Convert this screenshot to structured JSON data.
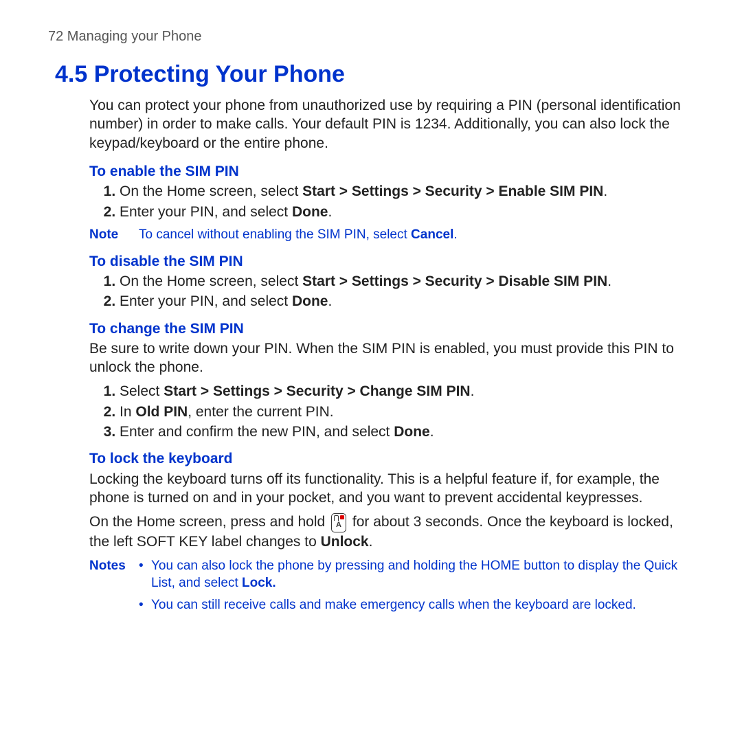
{
  "page_header": "72  Managing your Phone",
  "title": "4.5  Protecting Your Phone",
  "intro": "You can protect your phone from unauthorized use by requiring a PIN (personal identification number) in order to make calls. Your default PIN is 1234. Additionally, you can also lock the keypad/keyboard or the entire phone.",
  "sec1": {
    "head": "To enable the SIM PIN",
    "step1_pre": "On the Home screen, select ",
    "step1_bold": "Start > Settings > Security > Enable SIM PIN",
    "step1_post": ".",
    "step2_pre": "Enter your PIN, and select ",
    "step2_bold": "Done",
    "step2_post": ".",
    "note_label": "Note",
    "note_pre": "To cancel without enabling the SIM PIN, select ",
    "note_bold": "Cancel",
    "note_post": "."
  },
  "sec2": {
    "head": "To disable the SIM PIN",
    "step1_pre": "On the Home screen, select ",
    "step1_bold": "Start > Settings > Security > Disable SIM PIN",
    "step1_post": ".",
    "step2_pre": "Enter your PIN, and select ",
    "step2_bold": "Done",
    "step2_post": "."
  },
  "sec3": {
    "head": "To change the SIM PIN",
    "desc": "Be sure to write down your PIN. When the SIM PIN is enabled, you must provide this PIN to unlock the phone.",
    "step1_pre": "Select ",
    "step1_bold": "Start > Settings > Security > Change SIM PIN",
    "step1_post": ".",
    "step2_pre": "In ",
    "step2_bold": "Old PIN",
    "step2_post": ", enter the current PIN.",
    "step3_pre": "Enter and confirm the new PIN, and select ",
    "step3_bold": "Done",
    "step3_post": "."
  },
  "sec4": {
    "head": "To lock the keyboard",
    "desc": "Locking the keyboard turns off its functionality. This is a helpful feature if, for example, the phone is turned on and in your pocket, and you want to prevent accidental keypresses.",
    "line2a": "On the Home screen, press and hold ",
    "line2b": " for about 3 seconds. Once the keyboard is locked, the left SOFT KEY label changes to ",
    "line2_bold": "Unlock",
    "line2c": ".",
    "notes_label": "Notes",
    "n1_pre": "You can also lock the phone by pressing and holding the HOME button to display the Quick List, and select ",
    "n1_bold": "Lock.",
    "n2": "You can still receive calls and make emergency calls when the keyboard are locked."
  }
}
